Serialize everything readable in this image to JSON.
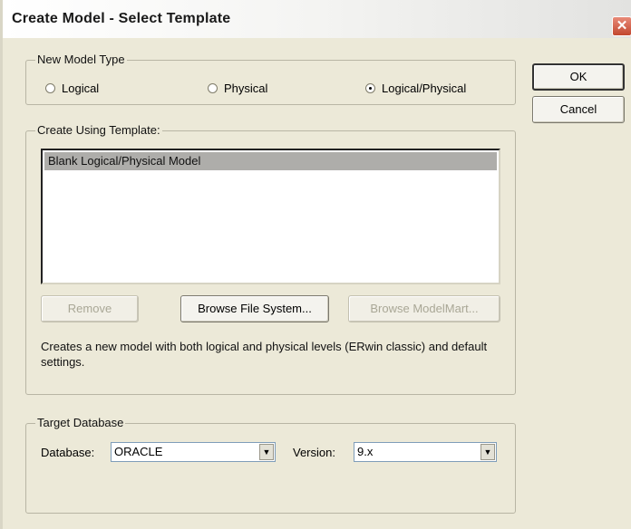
{
  "window": {
    "title": "Create Model - Select Template",
    "close_glyph": "✕"
  },
  "new_model_type": {
    "legend": "New Model Type",
    "options": [
      {
        "label": "Logical",
        "selected": false
      },
      {
        "label": "Physical",
        "selected": false
      },
      {
        "label": "Logical/Physical",
        "selected": true
      }
    ]
  },
  "buttons": {
    "ok": "OK",
    "cancel": "Cancel",
    "remove": "Remove",
    "browse_fs": "Browse File System...",
    "browse_mm": "Browse ModelMart..."
  },
  "template": {
    "legend": "Create Using Template:",
    "items": [
      "Blank Logical/Physical Model"
    ],
    "selected_index": 0,
    "description": "Creates a new model with both logical and physical levels (ERwin classic) and default settings."
  },
  "target_database": {
    "legend": "Target Database",
    "database_label": "Database:",
    "database_value": "ORACLE",
    "version_label": "Version:",
    "version_value": "9.x"
  },
  "icons": {
    "close": "close-icon",
    "dropdown": "chevron-down-icon"
  }
}
